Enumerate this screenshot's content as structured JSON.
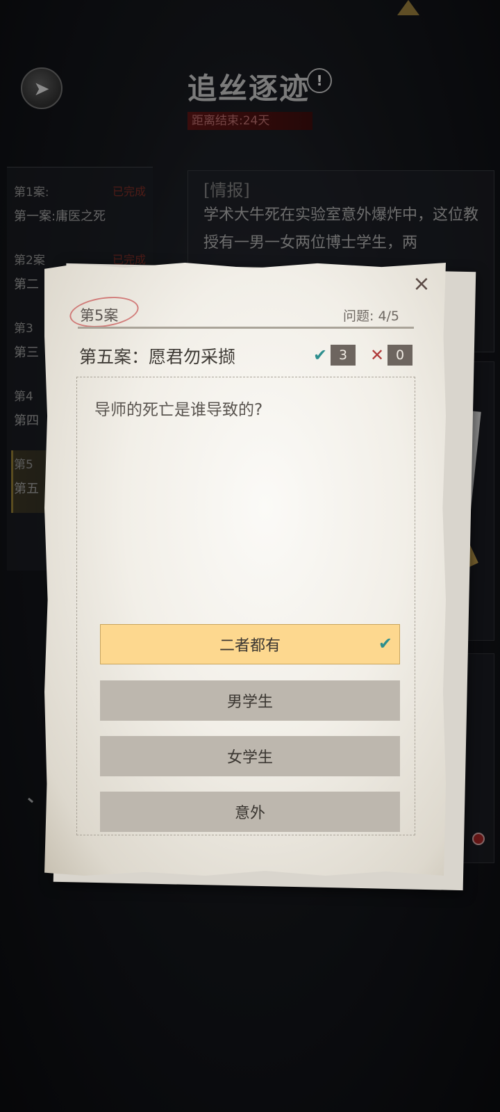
{
  "header": {
    "back_icon": "back-arrow-icon",
    "title": "追丝逐迹",
    "info_glyph": "!",
    "countdown": "距离结束:24天"
  },
  "sidebar": {
    "items": [
      {
        "number": "第1案:",
        "status": "已完成",
        "name": "第一案:庸医之死"
      },
      {
        "number": "第2案",
        "status": "已完成",
        "name": "第二"
      },
      {
        "number": "第3",
        "status": "",
        "name": "第三"
      },
      {
        "number": "第4",
        "status": "",
        "name": "第四"
      },
      {
        "number": "第5",
        "status": "",
        "name": "第五"
      }
    ]
  },
  "intel": {
    "label": "[情报]",
    "text": "学术大牛死在实验室意外爆炸中，这位教授有一男一女两位博士学生，两"
  },
  "modal": {
    "close_glyph": "×",
    "case_tag": "第5案",
    "progress": "问题: 4/5",
    "case_title": "第五案：愿君勿采撷",
    "correct_glyph": "✔",
    "correct_count": "3",
    "wrong_glyph": "✕",
    "wrong_count": "0",
    "question": "导师的死亡是谁导致的?",
    "options": [
      {
        "label": "二者都有",
        "selected": true,
        "check": "✔"
      },
      {
        "label": "男学生",
        "selected": false
      },
      {
        "label": "女学生",
        "selected": false
      },
      {
        "label": "意外",
        "selected": false
      }
    ]
  },
  "colors": {
    "selected_option": "#fdd88f",
    "option": "#bdb7ae",
    "correct": "#2e8f8e",
    "wrong": "#b03a3a",
    "countdown_bg": "#5a1414"
  }
}
